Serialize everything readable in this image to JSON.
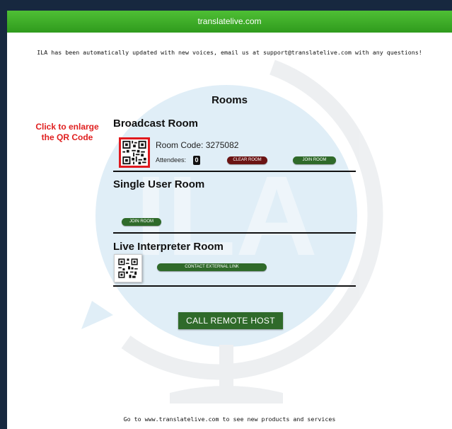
{
  "header": {
    "title": "translatelive.com"
  },
  "notice": {
    "text": "ILA has been automatically updated with new voices, email us at support@translatelive.com with any questions!"
  },
  "watermark": {
    "text": "ILA"
  },
  "rooms": {
    "title": "Rooms",
    "broadcast": {
      "heading": "Broadcast Room",
      "room_code": "Room Code: 3275082",
      "attendees_label": "Attendees:",
      "attendees_count": "0",
      "clear_label": "CLEAR ROOM",
      "join_label": "JOIN ROOM"
    },
    "single_user": {
      "heading": "Single User Room",
      "join_label": "JOIN ROOM"
    },
    "live_interpreter": {
      "heading": "Live Interpreter Room",
      "contact_label": "CONTACT EXTERNAL LINK"
    }
  },
  "call_remote_host": {
    "label": "CALL REMOTE HOST"
  },
  "footer": {
    "text": "Go to www.translatelive.com to see new products and services"
  },
  "annotation": {
    "line1": "Click to enlarge",
    "line2": "the QR Code"
  },
  "colors": {
    "header_green": "#3aa92a",
    "button_green": "#2f6a2a",
    "clear_red": "#6b1414",
    "annotation_red": "#e02020",
    "background_navy": "#17283f"
  }
}
